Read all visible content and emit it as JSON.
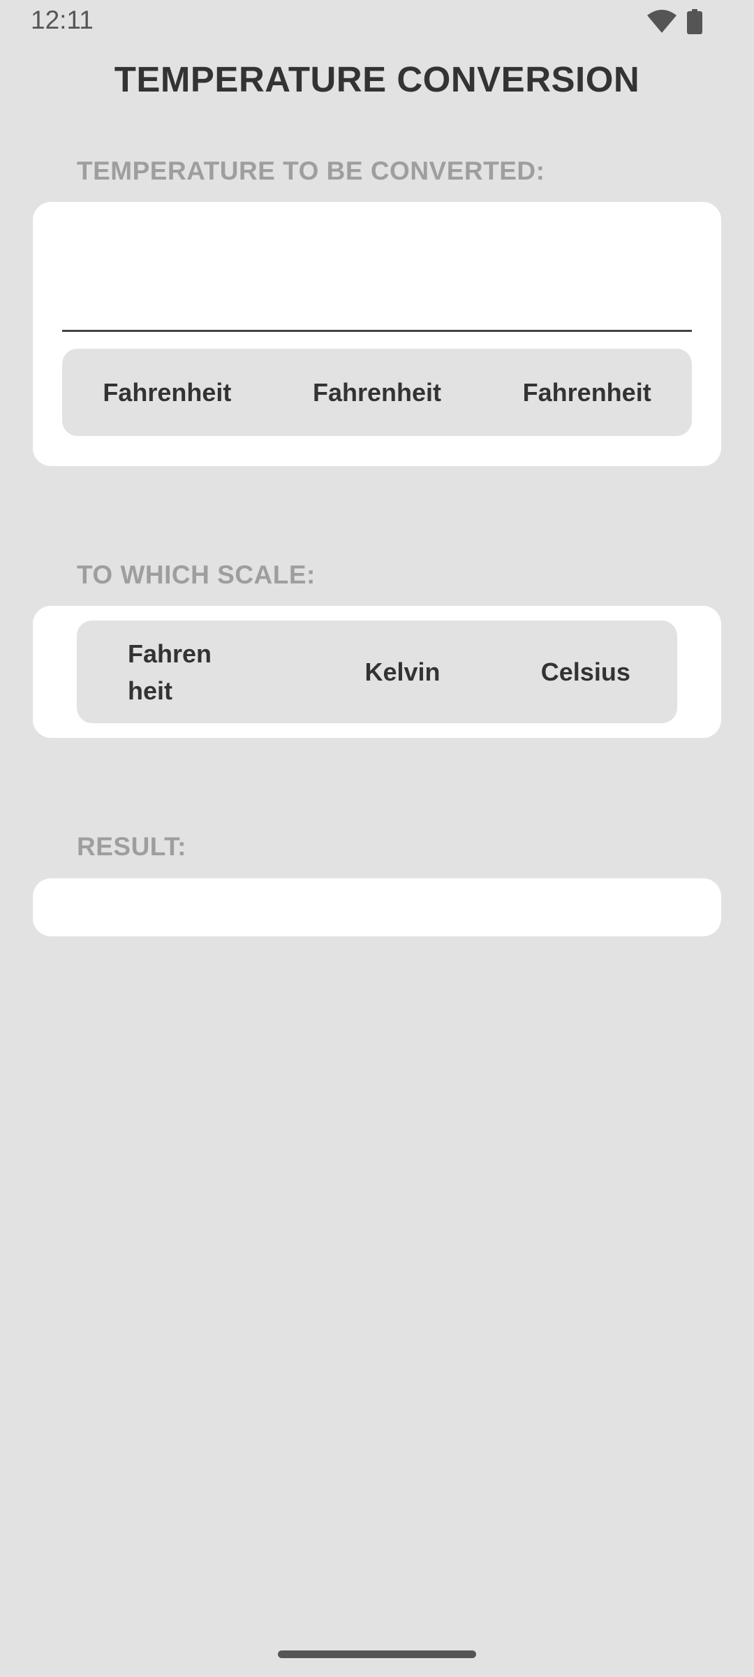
{
  "status_bar": {
    "time": "12:11",
    "icons": [
      "wifi-icon",
      "battery-icon"
    ]
  },
  "title": "TEMPERATURE CONVERSION",
  "input_section": {
    "label": "TEMPERATURE TO BE CONVERTED:",
    "input_value": "",
    "input_placeholder": "",
    "scales": [
      "Fahrenheit",
      "Fahrenheit",
      "Fahrenheit"
    ]
  },
  "target_section": {
    "label": "TO WHICH SCALE:",
    "scales": [
      "Fahrenheit",
      "Kelvin",
      "Celsius"
    ]
  },
  "result_section": {
    "label": "RESULT:",
    "value": ""
  },
  "colors": {
    "background": "#e2e2e2",
    "card": "#ffffff",
    "label": "#9e9e9e",
    "text": "#333333"
  }
}
